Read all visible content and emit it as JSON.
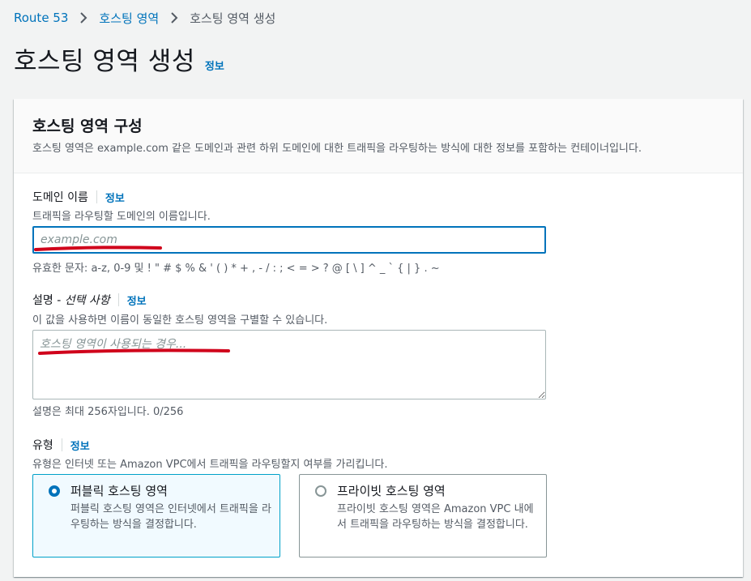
{
  "breadcrumb": {
    "items": [
      "Route 53",
      "호스팅 영역",
      "호스팅 영역 생성"
    ]
  },
  "page": {
    "title": "호스팅 영역 생성",
    "info": "정보"
  },
  "panel": {
    "title": "호스팅 영역 구성",
    "description": "호스팅 영역은 example.com 같은 도메인과 관련 하위 도메인에 대한 트래픽을 라우팅하는 방식에 대한 정보를 포함하는 컨테이너입니다."
  },
  "domain_field": {
    "label": "도메인 이름",
    "info": "정보",
    "description": "트래픽을 라우팅할 도메인의 이름입니다.",
    "value": "",
    "placeholder": "example.com",
    "constraint": "유효한 문자: a-z, 0-9 및 ! \" # $ % & ' ( ) * + , - / : ; < = > ? @ [ \\ ] ^ _ ` { | } . ~"
  },
  "description_field": {
    "label": "설명 - ",
    "label_optional": "선택 사항",
    "info": "정보",
    "description": "이 값을 사용하면 이름이 동일한 호스팅 영역을 구별할 수 있습니다.",
    "value": "",
    "placeholder": "호스팅 영역이 사용되는 경우...",
    "constraint": "설명은 최대 256자입니다. 0/256"
  },
  "type_field": {
    "label": "유형",
    "info": "정보",
    "description": "유형은 인터넷 또는 Amazon VPC에서 트래픽을 라우팅할지 여부를 가리킵니다.",
    "options": [
      {
        "title": "퍼블릭 호스팅 영역",
        "description": "퍼블릭 호스팅 영역은 인터넷에서 트래픽을 라우팅하는 방식을 결정합니다.",
        "selected": true
      },
      {
        "title": "프라이빗 호스팅 영역",
        "description": "프라이빗 호스팅 영역은 Amazon VPC 내에서 트래픽을 라우팅하는 방식을 결정합니다.",
        "selected": false
      }
    ]
  },
  "colors": {
    "link": "#0073bb",
    "annotation": "#d0021b",
    "selected_border": "#00a1c9",
    "selected_bg": "#f1faff"
  }
}
